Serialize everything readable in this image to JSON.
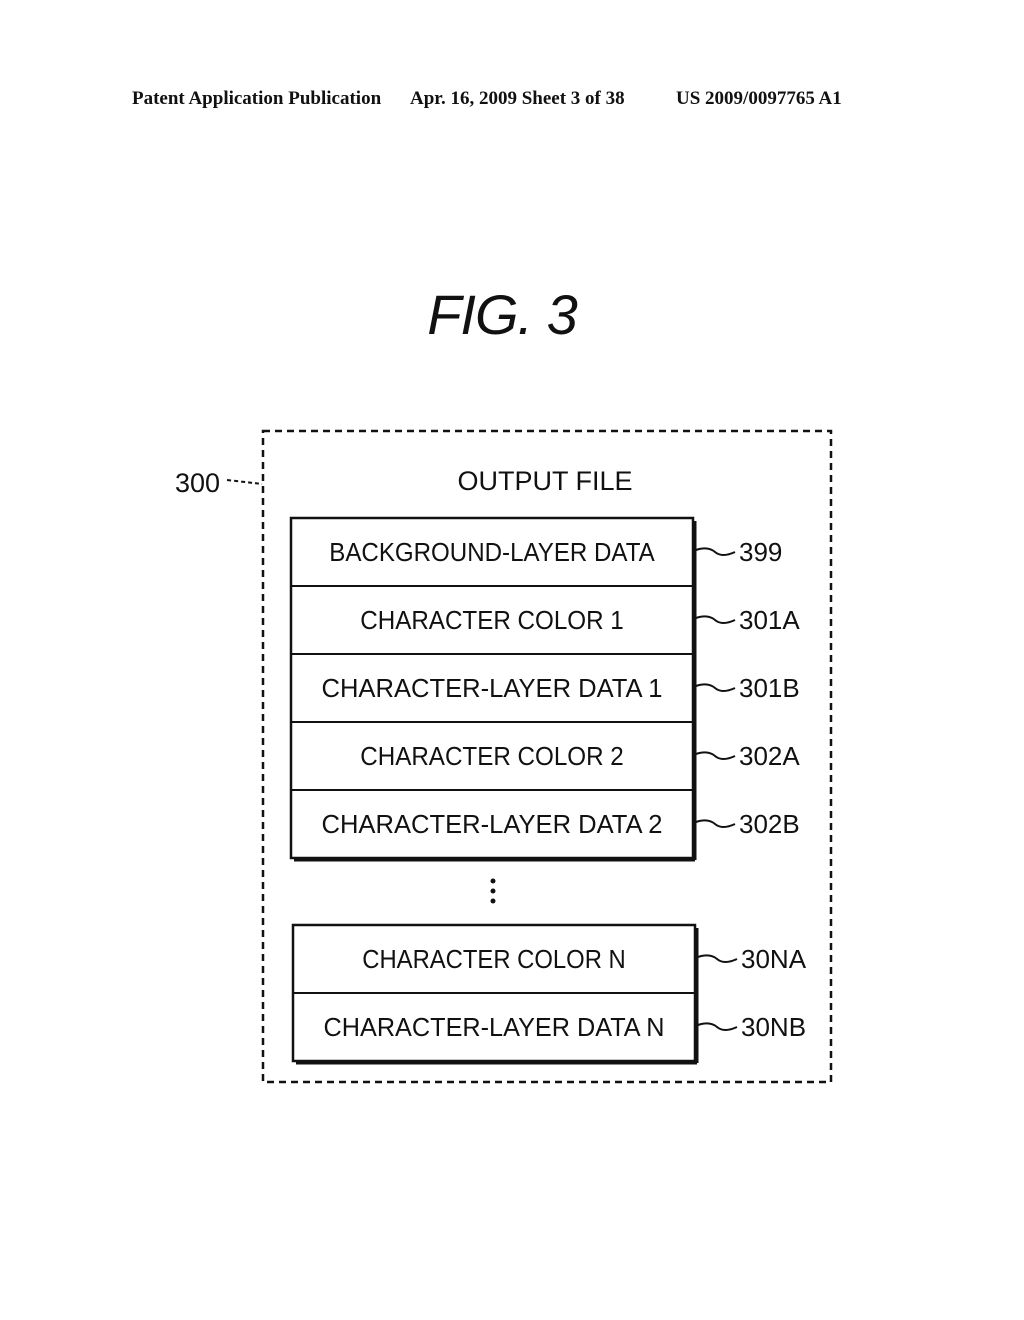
{
  "header": {
    "left": "Patent Application Publication",
    "center": "Apr. 16, 2009  Sheet 3 of 38",
    "right": "US 2009/0097765 A1"
  },
  "figure": {
    "title": "FIG. 3",
    "container_label": "OUTPUT FILE",
    "container_ref": "300",
    "group1": [
      {
        "label": "BACKGROUND-LAYER DATA",
        "ref": "399"
      },
      {
        "label": "CHARACTER COLOR 1",
        "ref": "301A"
      },
      {
        "label": "CHARACTER-LAYER DATA 1",
        "ref": "301B"
      },
      {
        "label": "CHARACTER COLOR 2",
        "ref": "302A"
      },
      {
        "label": "CHARACTER-LAYER DATA 2",
        "ref": "302B"
      }
    ],
    "ellipsis": "⋮",
    "group2": [
      {
        "label": "CHARACTER COLOR N",
        "ref": "30NA"
      },
      {
        "label": "CHARACTER-LAYER DATA N",
        "ref": "30NB"
      }
    ]
  }
}
